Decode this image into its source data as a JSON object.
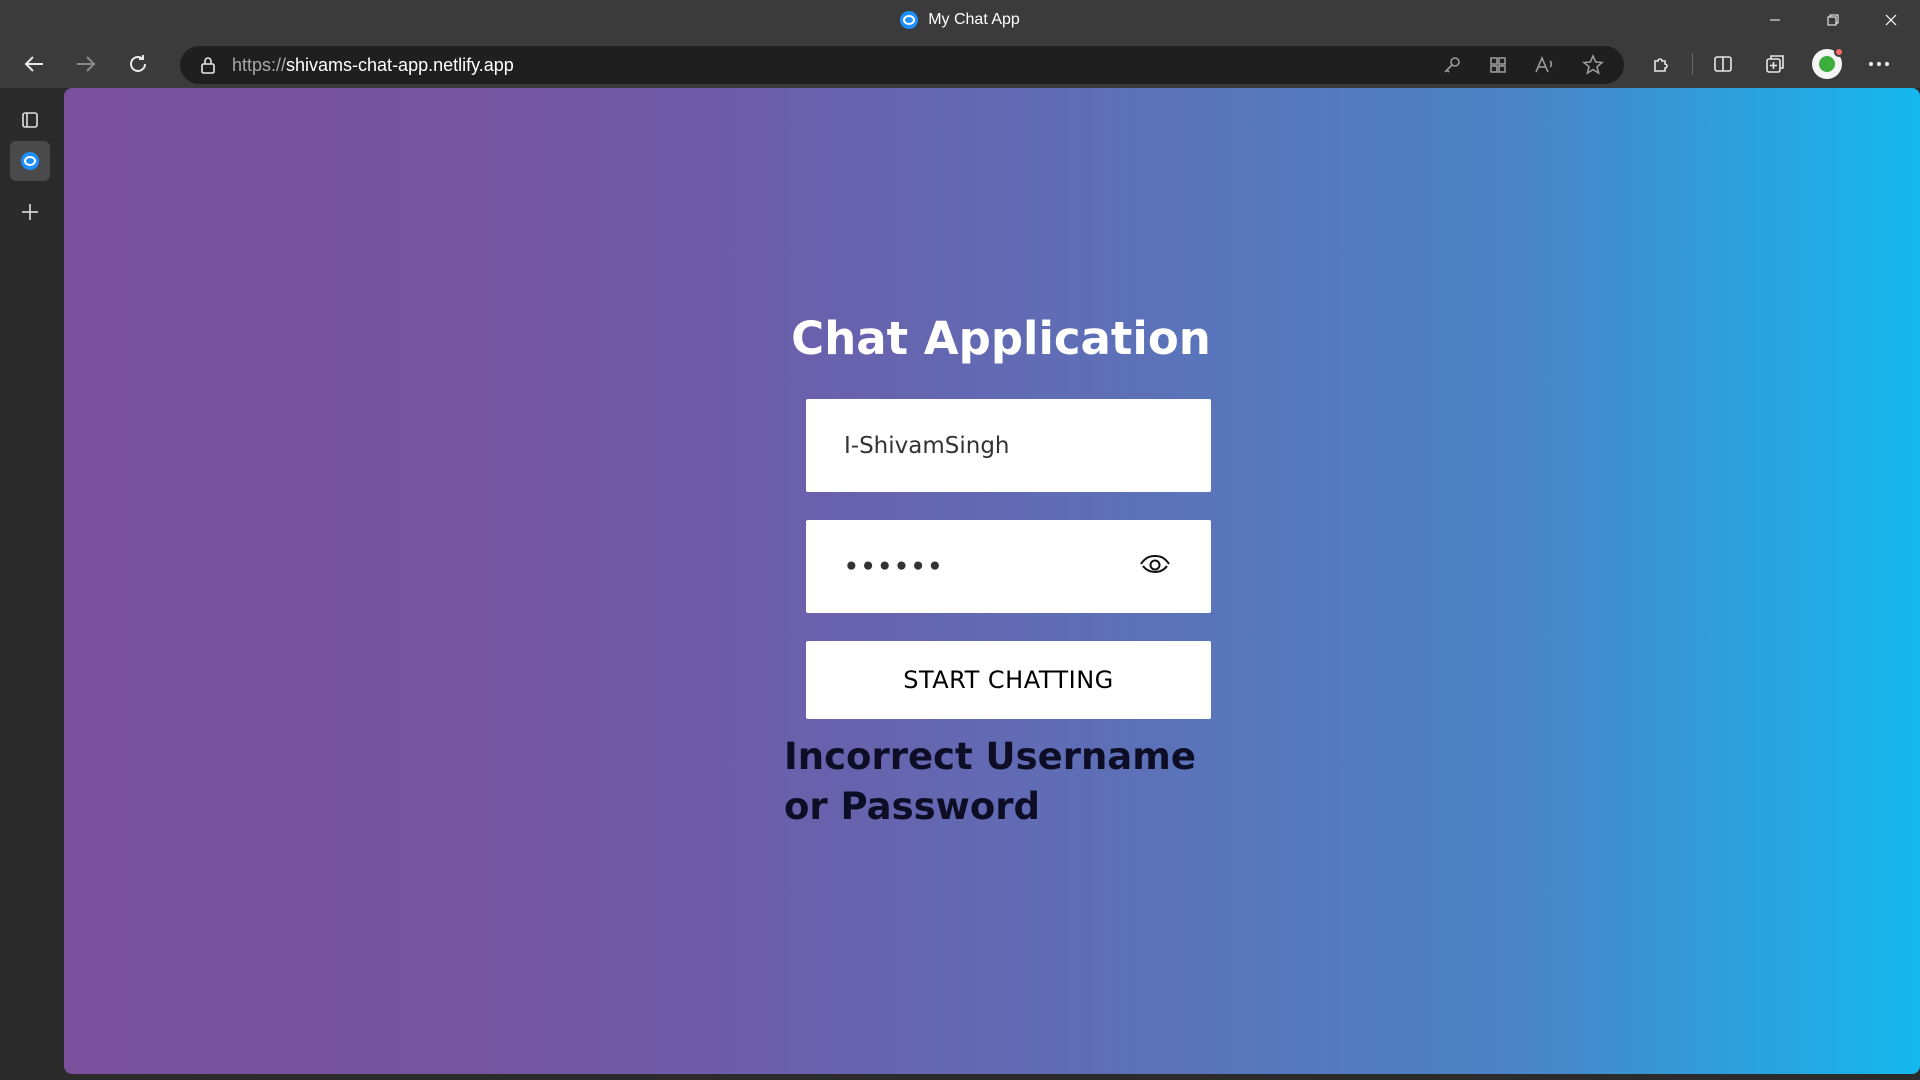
{
  "window": {
    "title": "My Chat App",
    "favicon_icon": "chat-bubble-icon",
    "controls": [
      "minimize-icon",
      "restore-icon",
      "close-icon"
    ]
  },
  "toolbar": {
    "back_icon": "back-arrow-icon",
    "forward_icon": "forward-arrow-icon",
    "refresh_icon": "refresh-icon",
    "address": {
      "protocol": "https://",
      "host": "shivams-chat-app.netlify.app"
    },
    "address_icons": [
      "key-icon",
      "apps-icon",
      "read-aloud-icon",
      "favorite-star-icon"
    ],
    "right_icons": [
      "extensions-icon",
      "split-screen-icon",
      "collections-icon",
      "profile-avatar",
      "more-menu-icon"
    ]
  },
  "sidebar": {
    "items": [
      "tab-actions-icon",
      "chat-app-tab-icon",
      "new-tab-plus-icon"
    ]
  },
  "login": {
    "title": "Chat Application",
    "username_value": "I-ShivamSingh",
    "password_value": "••••••",
    "submit_label": "START CHATTING",
    "error_message": "Incorrect Username or Password"
  },
  "colors": {
    "gradient_start": "#7a4f9c",
    "gradient_end": "#15b8ee",
    "browser_chrome": "#3b3b3b",
    "error_text": "#0d0d26"
  }
}
